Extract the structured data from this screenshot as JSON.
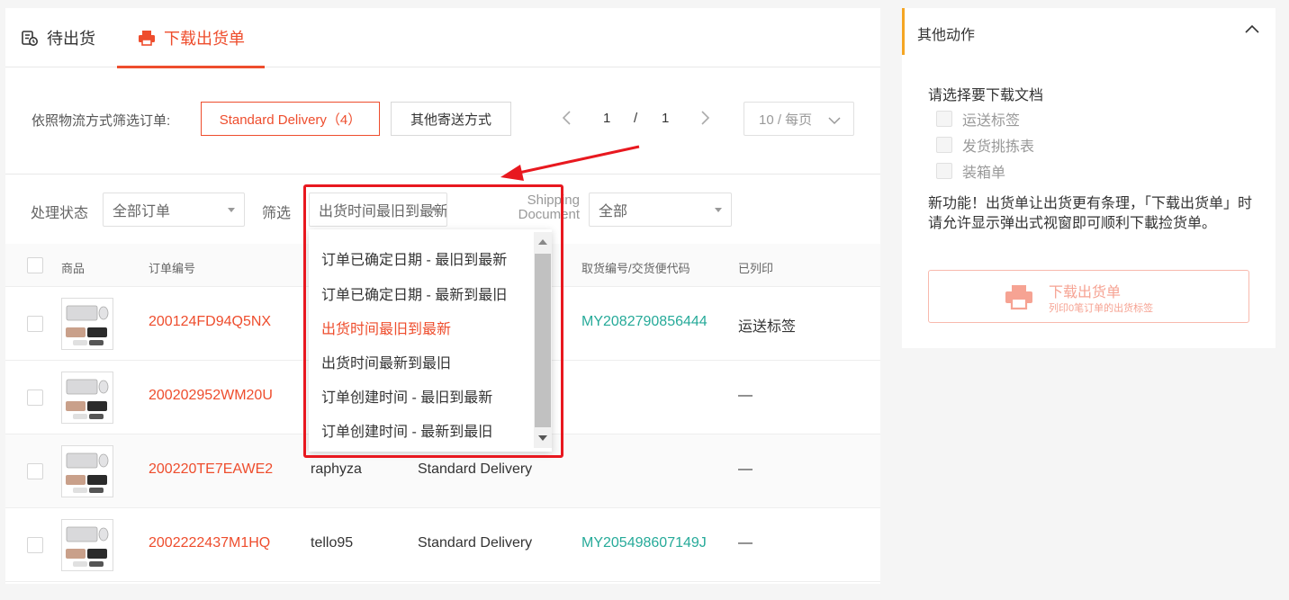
{
  "tabs": [
    {
      "label": "待出货"
    },
    {
      "label": "下载出货单"
    }
  ],
  "filter": {
    "label": "依照物流方式筛选订单:",
    "standard_delivery": "Standard Delivery（4）",
    "other_methods": "其他寄送方式"
  },
  "pagination": {
    "current": "1",
    "separator": "/",
    "total": "1",
    "page_size": "10 / 每页"
  },
  "toolbar": {
    "status_label": "处理状态",
    "status_value": "全部订单",
    "sort_label": "筛选",
    "sort_value": "出货时间最旧到最新",
    "doc_label": "Shipping Document",
    "doc_value": "全部"
  },
  "table": {
    "headers": [
      "商品",
      "订单编号",
      "",
      "",
      "取货编号/交货便代码",
      "已列印"
    ],
    "rows": [
      {
        "order": "200124FD94Q5NX",
        "buyer": "",
        "shipping": "",
        "tracking": "MY2082790856444",
        "printed": "运送标签"
      },
      {
        "order": "200202952WM20U",
        "buyer": "",
        "shipping": "",
        "tracking": "",
        "printed": "—"
      },
      {
        "order": "200220TE7EAWE2",
        "buyer": "raphyza",
        "shipping": "Standard Delivery",
        "tracking": "",
        "printed": "—"
      },
      {
        "order": "2002222437M1HQ",
        "buyer": "tello95",
        "shipping": "Standard Delivery",
        "tracking": "MY205498607149J",
        "printed": "—"
      }
    ]
  },
  "dropdown": {
    "options": [
      "订单已确定日期 - 最旧到最新",
      "订单已确定日期 - 最新到最旧",
      "出货时间最旧到最新",
      "出货时间最新到最旧",
      "订单创建时间 - 最旧到最新",
      "订单创建时间 - 最新到最旧"
    ],
    "active_index": 2
  },
  "side": {
    "title": "其他动作",
    "subtitle": "请选择要下载文档",
    "checkboxes": [
      "运送标签",
      "发货挑拣表",
      "装箱单"
    ],
    "description": "新功能！出货单让出货更有条理，「下载出货单」时请允许显示弹出式视窗即可顺利下載捡货单。",
    "button_label": "下载出货单",
    "button_sub": "列印0笔订单的出货标签"
  },
  "colors": {
    "accent": "#ee4d2d",
    "tracking": "#26aa99",
    "highlight": "#e8181f",
    "side_marker": "#f5a623"
  }
}
